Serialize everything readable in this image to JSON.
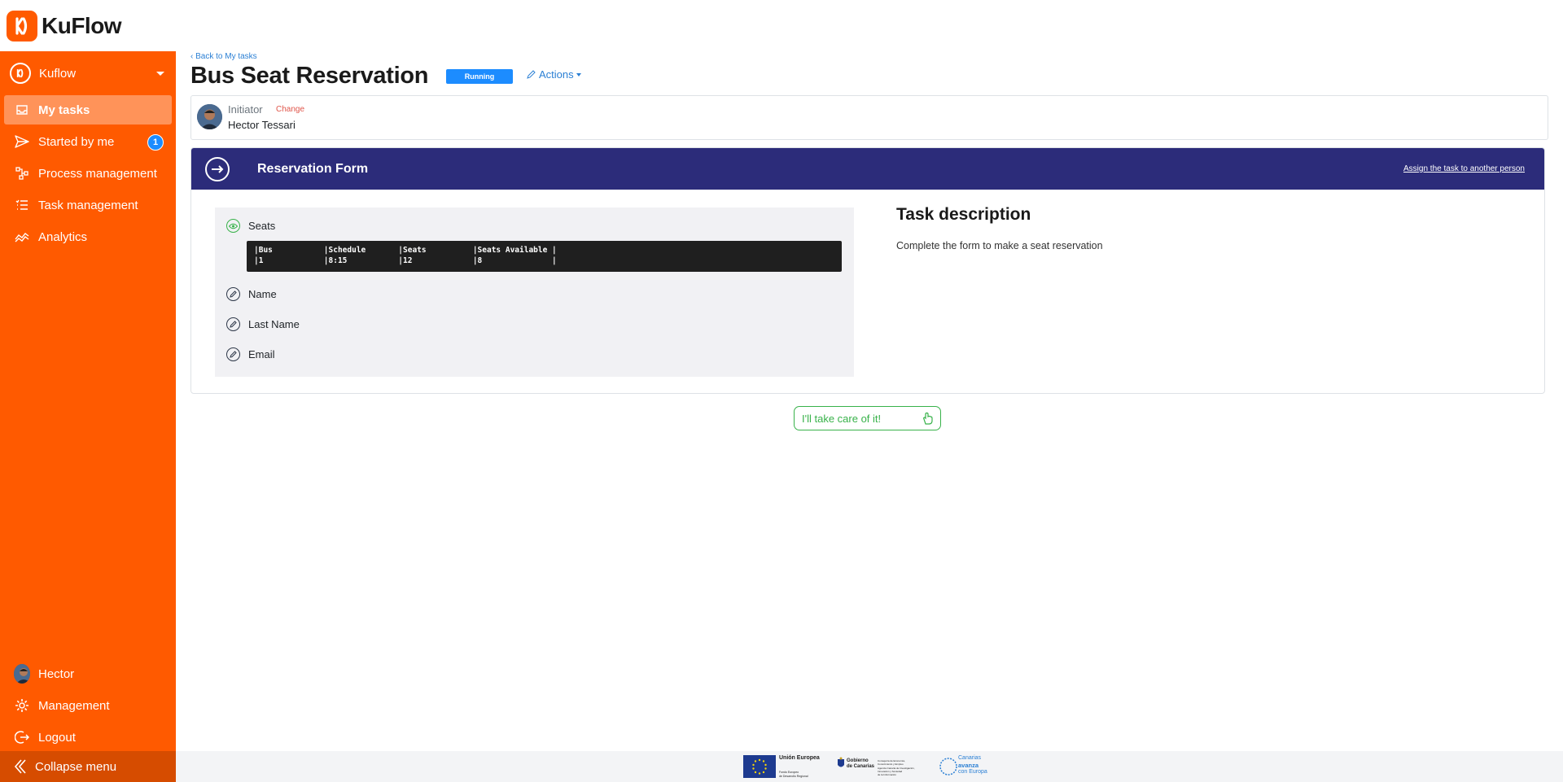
{
  "brand": {
    "name": "KuFlow",
    "color": "#ff5a00"
  },
  "sidebar": {
    "workspace": "Kuflow",
    "items": [
      {
        "label": "My tasks",
        "icon": "inbox-icon",
        "active": true
      },
      {
        "label": "Started by me",
        "icon": "send-icon",
        "badge": "1"
      },
      {
        "label": "Process management",
        "icon": "flow-icon"
      },
      {
        "label": "Task management",
        "icon": "checklist-icon"
      },
      {
        "label": "Analytics",
        "icon": "chart-icon"
      }
    ],
    "user": "Hector",
    "management": "Management",
    "logout": "Logout",
    "collapse": "Collapse menu"
  },
  "header": {
    "back": "Back to My tasks",
    "title": "Bus Seat Reservation",
    "status": "Running",
    "actions": "Actions"
  },
  "initiator": {
    "label": "Initiator",
    "change": "Change",
    "name": "Hector Tessari"
  },
  "form": {
    "title": "Reservation Form",
    "assign_link": "Assign the task to another person",
    "fields": [
      {
        "label": "Seats",
        "icon": "eye-icon"
      },
      {
        "label": "Name",
        "icon": "edit-icon"
      },
      {
        "label": "Last Name",
        "icon": "edit-icon"
      },
      {
        "label": "Email",
        "icon": "edit-icon"
      }
    ],
    "code_lines": [
      "|Bus           |Schedule       |Seats          |Seats Available |",
      "|1             |8:15           |12             |8               |"
    ]
  },
  "task": {
    "title": "Task description",
    "text": "Complete the form to make a seat reservation"
  },
  "take_button": "I'll take care of it!",
  "footer": {
    "eu": "Unión Europea",
    "eu_sub1": "Fondo Europeo",
    "eu_sub2": "de Desarrollo Regional",
    "gob1": "Gobierno",
    "gob2": "de Canarias",
    "gob_dept1": "Consejería de Economía,",
    "gob_dept2": "Conocimiento y Empleo",
    "gob_dept3": "Agencia Canaria de Investigación,",
    "gob_dept4": "Innovación y Sociedad",
    "gob_dept5": "de la Información",
    "canarias1": "Canarias",
    "canarias2": "avanza",
    "canarias3": "con Europa"
  }
}
